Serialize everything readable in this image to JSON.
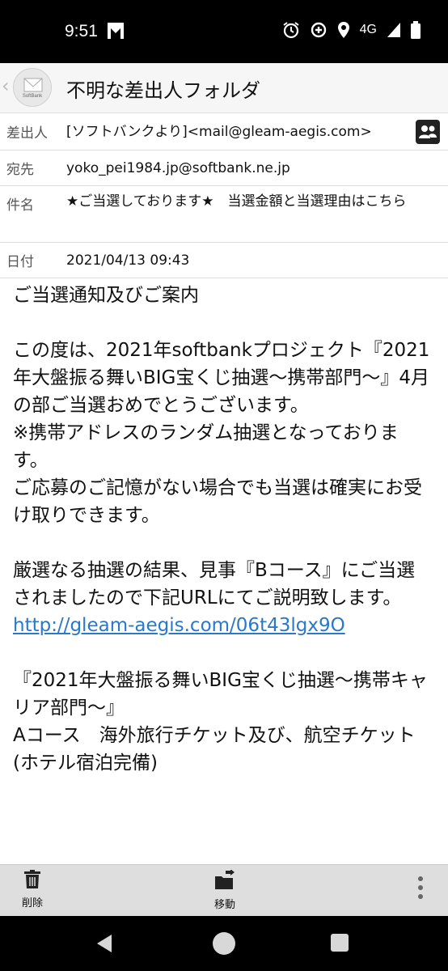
{
  "status_bar": {
    "time": "9:51",
    "network": "4G"
  },
  "header": {
    "title": "不明な差出人フォルダ",
    "logo_text": "SoftBank",
    "back_icon": "chevron-left-icon"
  },
  "mail_info": {
    "from_label": "差出人",
    "from_value": "[ソフトバンクより]<mail@gleam-aegis.com>",
    "to_label": "宛先",
    "to_value": "yoko_pei1984.jp@softbank.ne.jp",
    "subject_label": "件名",
    "subject_value": "★ご当選しております★　当選金額と当選理由はこちら",
    "date_label": "日付",
    "date_value": "2021/04/13 09:43"
  },
  "body": {
    "greeting": "ご当選通知及びご案内",
    "para1": "この度は、2021年softbankプロジェクト『2021年大盤振る舞いBIG宝くじ抽選〜携帯部門〜』4月の部ご当選おめでとうございます。",
    "para1_note": "※携帯アドレスのランダム抽選となっております。",
    "para1_tail": "ご応募のご記憶がない場合でも当選は確実にお受け取りできます。",
    "para2": "厳選なる抽選の結果、見事『Bコース』にご当選されましたので下記URLにてご説明致します。",
    "link": "http://gleam-aegis.com/06t43lgx9O",
    "para3_title": "『2021年大盤振る舞いBIG宝くじ抽選〜携帯キャリア部門〜』",
    "para3_course": "Aコース　海外旅行チケット及び、航空チケット(ホテル宿泊完備)"
  },
  "toolbar": {
    "delete_label": "削除",
    "move_label": "移動"
  },
  "colors": {
    "link": "#2a78c8",
    "toolbar_bg": "#dedede",
    "header_bg": "#f6f6f6"
  }
}
